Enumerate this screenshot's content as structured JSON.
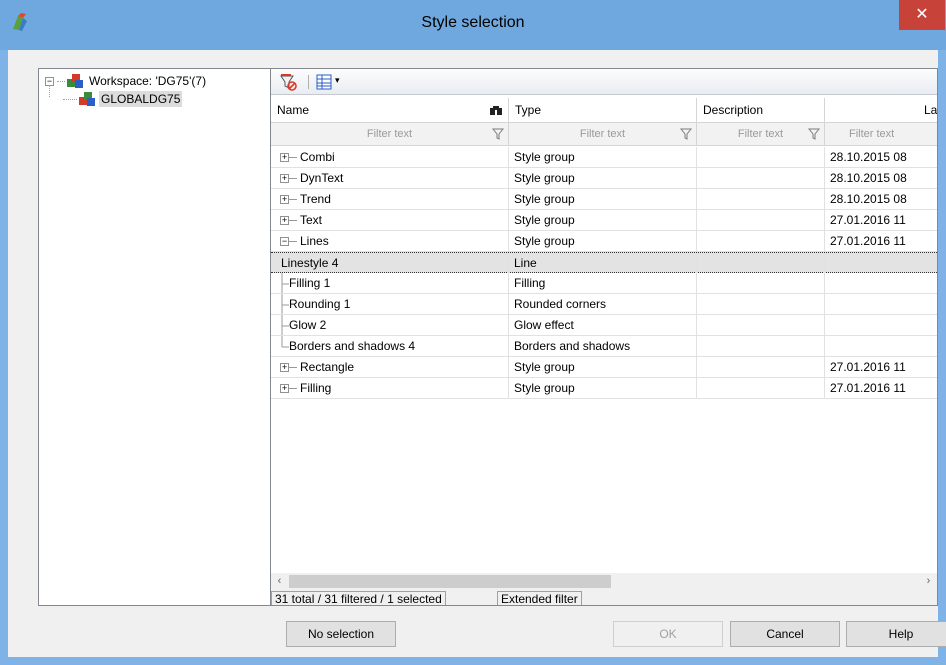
{
  "window": {
    "title": "Style selection",
    "close_glyph": "✕"
  },
  "tree": {
    "workspace_label": "Workspace: 'DG75'(7)",
    "project_label": "GLOBALDG75",
    "expander": "−"
  },
  "toolbar": {
    "remove_filter_icon": "filter-remove-icon",
    "columns_icon": "column-chooser-icon",
    "dropdown_glyph": "▾"
  },
  "columns": {
    "name": "Name",
    "type": "Type",
    "description": "Description",
    "last": "Last m"
  },
  "filter_placeholder": "Filter text",
  "rows": [
    {
      "name": "Combi",
      "type": "Style group",
      "last": "28.10.2015 08",
      "expander": "+",
      "level": 0
    },
    {
      "name": "DynText",
      "type": "Style group",
      "last": "28.10.2015 08",
      "expander": "+",
      "level": 0
    },
    {
      "name": "Trend",
      "type": "Style group",
      "last": "28.10.2015 08",
      "expander": "+",
      "level": 0
    },
    {
      "name": "Text",
      "type": "Style group",
      "last": "27.01.2016 11",
      "expander": "+",
      "level": 0
    },
    {
      "name": "Lines",
      "type": "Style group",
      "last": "27.01.2016 11",
      "expander": "−",
      "level": 0
    },
    {
      "name": "Linestyle 4",
      "type": "Line",
      "last": "",
      "expander": "",
      "level": 1,
      "selected": true
    },
    {
      "name": "Filling 1",
      "type": "Filling",
      "last": "",
      "expander": "",
      "level": 1
    },
    {
      "name": "Rounding 1",
      "type": "Rounded corners",
      "last": "",
      "expander": "",
      "level": 1
    },
    {
      "name": "Glow 2",
      "type": "Glow effect",
      "last": "",
      "expander": "",
      "level": 1
    },
    {
      "name": "Borders and shadows 4",
      "type": "Borders and shadows",
      "last": "",
      "expander": "",
      "level": 1
    },
    {
      "name": "Rectangle",
      "type": "Style group",
      "last": "27.01.2016 11",
      "expander": "+",
      "level": 0
    },
    {
      "name": "Filling",
      "type": "Style group",
      "last": "27.01.2016 11",
      "expander": "+",
      "level": 0
    }
  ],
  "scroll": {
    "left_glyph": "‹",
    "right_glyph": "›"
  },
  "status": {
    "counts": "31 total / 31 filtered / 1 selected",
    "extended_filter": "Extended filter"
  },
  "buttons": {
    "no_selection": "No selection",
    "ok": "OK",
    "cancel": "Cancel",
    "help": "Help"
  },
  "colors": {
    "title_bar": "#6fa8de",
    "close_button": "#c7433a",
    "selection_row": "#e3e3e3"
  }
}
